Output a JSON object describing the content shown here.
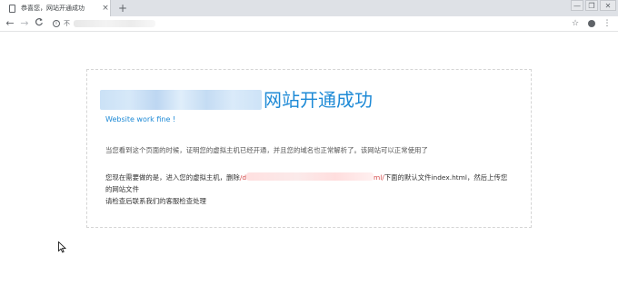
{
  "browser": {
    "tab": {
      "title": "恭喜您，网站开通成功",
      "close": "×"
    },
    "new_tab": "+",
    "window_controls": {
      "minimize": "—",
      "maximize": "❐",
      "close": "✕"
    },
    "nav": {
      "back": "←",
      "forward": "→",
      "reload": "C"
    },
    "omnibox": {
      "security_icon": "info-icon",
      "security_text": "不",
      "url_obscured": true
    },
    "toolbar_icons": {
      "bookmark": "☆",
      "menu": "⋮"
    }
  },
  "page": {
    "title_suffix": "网站开通成功",
    "subtitle": "Website work fine !",
    "para1": "当您看到这个页面的时候，证明您的虚拟主机已经开通，并且您的域名也正常解析了。该网站可以正常使用了",
    "para2": {
      "prefix": "您现在需要做的是，进入您的虚拟主机，删除",
      "path_start": "/d",
      "path_end": "ml/",
      "suffix": "下面的默认文件index.html，然后上传您",
      "line2": "的网站文件",
      "line3": "请检查后联系我们的客服检查处理"
    }
  },
  "colors": {
    "accent_blue": "#1e8ad6",
    "path_red": "#d44545",
    "body_text": "#555555"
  }
}
